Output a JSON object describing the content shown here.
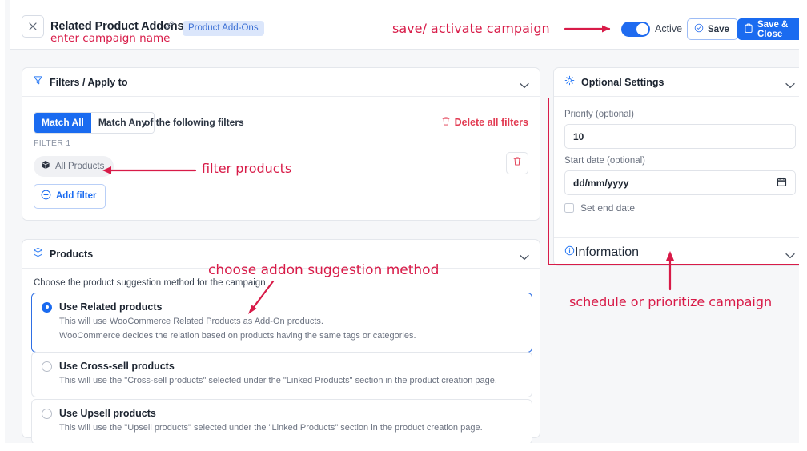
{
  "header": {
    "close_icon": "close-icon",
    "campaign_title": "Related Product Addons",
    "edit_icon": "pencil-icon",
    "badge": "Product Add-Ons",
    "toggle_label": "Active",
    "save_label": "Save",
    "save_icon": "check-circle-icon",
    "save_close_label": "Save & Close",
    "save_close_icon": "save-clipboard-icon"
  },
  "annotations": {
    "campaign_name": "enter campaign name",
    "save_activate": "save/ activate campaign",
    "filter_products": "filter products",
    "addon_method": "choose addon suggestion method",
    "schedule": "schedule or prioritize campaign"
  },
  "filters": {
    "title": "Filters / Apply to",
    "icon": "funnel-icon",
    "chevron": "chevron-down-icon",
    "match_all": "Match All",
    "match_any": "Match Any",
    "match_note": "of the following filters",
    "delete_all": "Delete all filters",
    "delete_all_icon": "trash-icon",
    "filter_index_label": "FILTER 1",
    "chip_label": "All Products",
    "chip_icon": "box-icon",
    "row_delete_icon": "trash-icon",
    "add_filter": "Add filter",
    "add_filter_icon": "plus-circle-icon"
  },
  "products": {
    "title": "Products",
    "icon": "package-icon",
    "chevron": "chevron-down-icon",
    "hint": "Choose the product suggestion method for the campaign",
    "options": [
      {
        "label": "Use Related products",
        "selected": true,
        "desc1": "This will use WooCommerce Related Products as Add-On products.",
        "desc2": "WooCommerce decides the relation based on products having the same tags or categories."
      },
      {
        "label": "Use Cross-sell products",
        "selected": false,
        "desc1": "This will use the \"Cross-sell products\" selected under the \"Linked Products\" section in the product creation page.",
        "desc2": ""
      },
      {
        "label": "Use Upsell products",
        "selected": false,
        "desc1": "This will use the \"Upsell products\" selected under the \"Linked Products\" section in the product creation page.",
        "desc2": ""
      }
    ]
  },
  "optional": {
    "title": "Optional Settings",
    "icon": "gear-icon",
    "chevron": "chevron-down-icon",
    "priority_label": "Priority (optional)",
    "priority_value": "10",
    "start_date_label": "Start date (optional)",
    "start_date_value": "dd/mm/yyyy",
    "calendar_icon": "calendar-icon",
    "set_end_date": "Set end date",
    "information_title": "Information",
    "information_icon": "info-icon",
    "information_chevron": "chevron-down-icon"
  },
  "colors": {
    "brand_blue": "#1a6bf0",
    "annotation_red": "#d81b48",
    "danger": "#e23b52",
    "badge_bg": "#dbe6fb"
  }
}
